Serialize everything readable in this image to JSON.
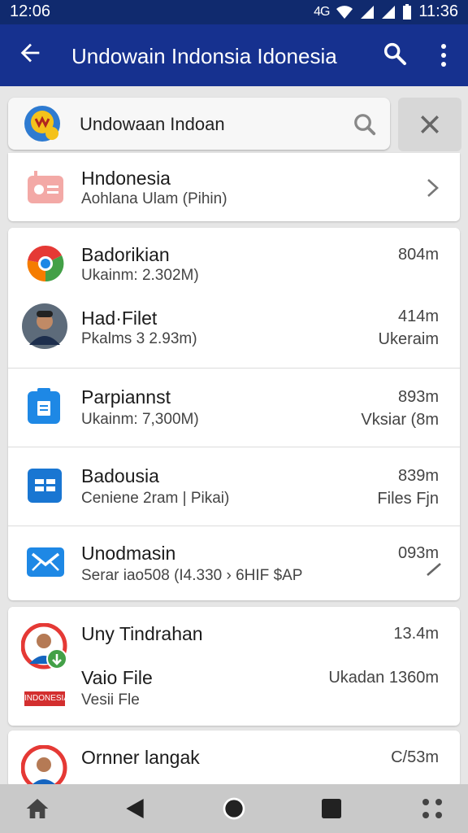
{
  "status_bar": {
    "time_left": "12:06",
    "time_right": "11:36",
    "signal_text": "4G"
  },
  "app_bar": {
    "title": "Undowain Indonsia Idonesia",
    "icons": [
      "back-arrow-icon",
      "search-icon",
      "more-vert-icon"
    ]
  },
  "search": {
    "value": "Undowaan Indoan"
  },
  "featured": {
    "title": "Hndonesia",
    "subtitle": "Aohlana Ulam (Pihin)"
  },
  "list": [
    {
      "title": "Badorikian",
      "subtitle": "Ukainm: 2.302M)",
      "meta": "804m",
      "meta2": "",
      "icon": "chrome-icon"
    },
    {
      "title": "Had·Filet",
      "subtitle": "Pkalms 3 2.93m)",
      "meta": "414m",
      "meta2": "Ukeraim",
      "icon": "avatar"
    },
    {
      "title": "Parpiannst",
      "subtitle": "Ukainm: 7,300M)",
      "meta": "893m",
      "meta2": "Vksiar (8m",
      "icon": "clipboard-icon"
    },
    {
      "title": "Badousia",
      "subtitle": "Ceniene 2ram | Pikai)",
      "meta": "839m",
      "meta2": "Files Fjn",
      "icon": "files-icon"
    },
    {
      "title": "Unodmasin",
      "subtitle": "Serar iao508 (I4.330 › 6HIF $AP",
      "meta": "093m",
      "meta2": "",
      "icon": "mail-icon"
    }
  ],
  "group": {
    "title": "Uny Tindrahan",
    "meta": "13.4m",
    "file_title": "Vaio File",
    "file_meta": "Ukadan 1360m",
    "file_sub": "Vesii Fle",
    "flag_label": "INDONESIA"
  },
  "last": {
    "title": "Ornner langak",
    "meta": "C/53m"
  },
  "colors": {
    "app_bar": "#16318f",
    "status_bar": "#102a6e",
    "accent_blue": "#1976d2"
  }
}
